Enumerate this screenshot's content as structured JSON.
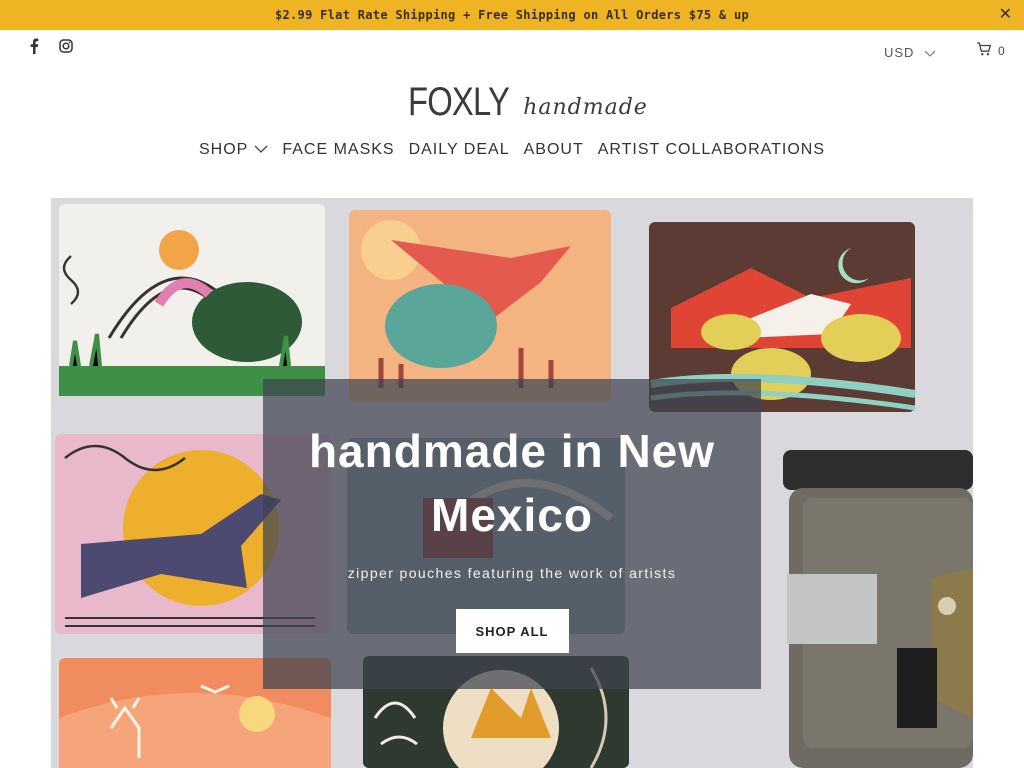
{
  "announcement": {
    "text": "$2.99 Flat Rate Shipping + Free Shipping on All Orders $75 & up",
    "close_glyph": "✕"
  },
  "social": {
    "icons": [
      "facebook-icon",
      "instagram-icon"
    ]
  },
  "currency": {
    "selected": "USD"
  },
  "cart": {
    "count": "0"
  },
  "logo": {
    "main": "FOXLY",
    "sub": "handmade"
  },
  "nav": {
    "items": [
      {
        "label": "SHOP",
        "has_dropdown": true
      },
      {
        "label": "FACE MASKS"
      },
      {
        "label": "DAILY DEAL"
      },
      {
        "label": "ABOUT"
      },
      {
        "label": "ARTIST COLLABORATIONS"
      }
    ]
  },
  "hero": {
    "title": "handmade in New Mexico",
    "subtitle": "zipper pouches featuring the work of artists",
    "button_label": "SHOP ALL"
  },
  "colors": {
    "announcement_bg": "#eeb424",
    "overlay": "#3e4450"
  }
}
